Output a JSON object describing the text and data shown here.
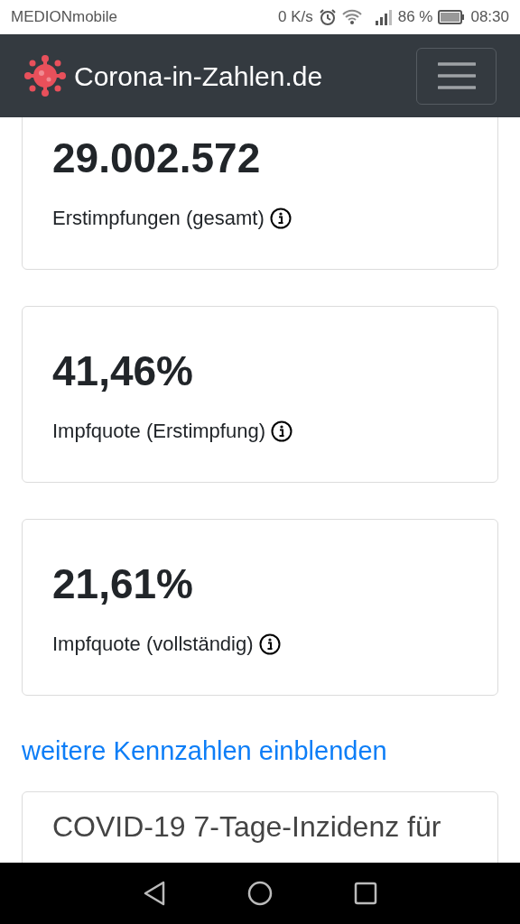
{
  "status_bar": {
    "carrier": "MEDIONmobile",
    "speed": "0 K/s",
    "battery": "86 %",
    "time": "08:30"
  },
  "navbar": {
    "brand": "Corona-in-Zahlen.de"
  },
  "stats": [
    {
      "value": "29.002.572",
      "label": "Erstimpfungen (gesamt)"
    },
    {
      "value": "41,46%",
      "label": "Impfquote (Erstimpfung)"
    },
    {
      "value": "21,61%",
      "label": "Impfquote (vollständig)"
    }
  ],
  "more_link": "weitere Kennzahlen einblenden",
  "next_card": {
    "title": "COVID-19 7-Tage-Inzidenz für"
  }
}
